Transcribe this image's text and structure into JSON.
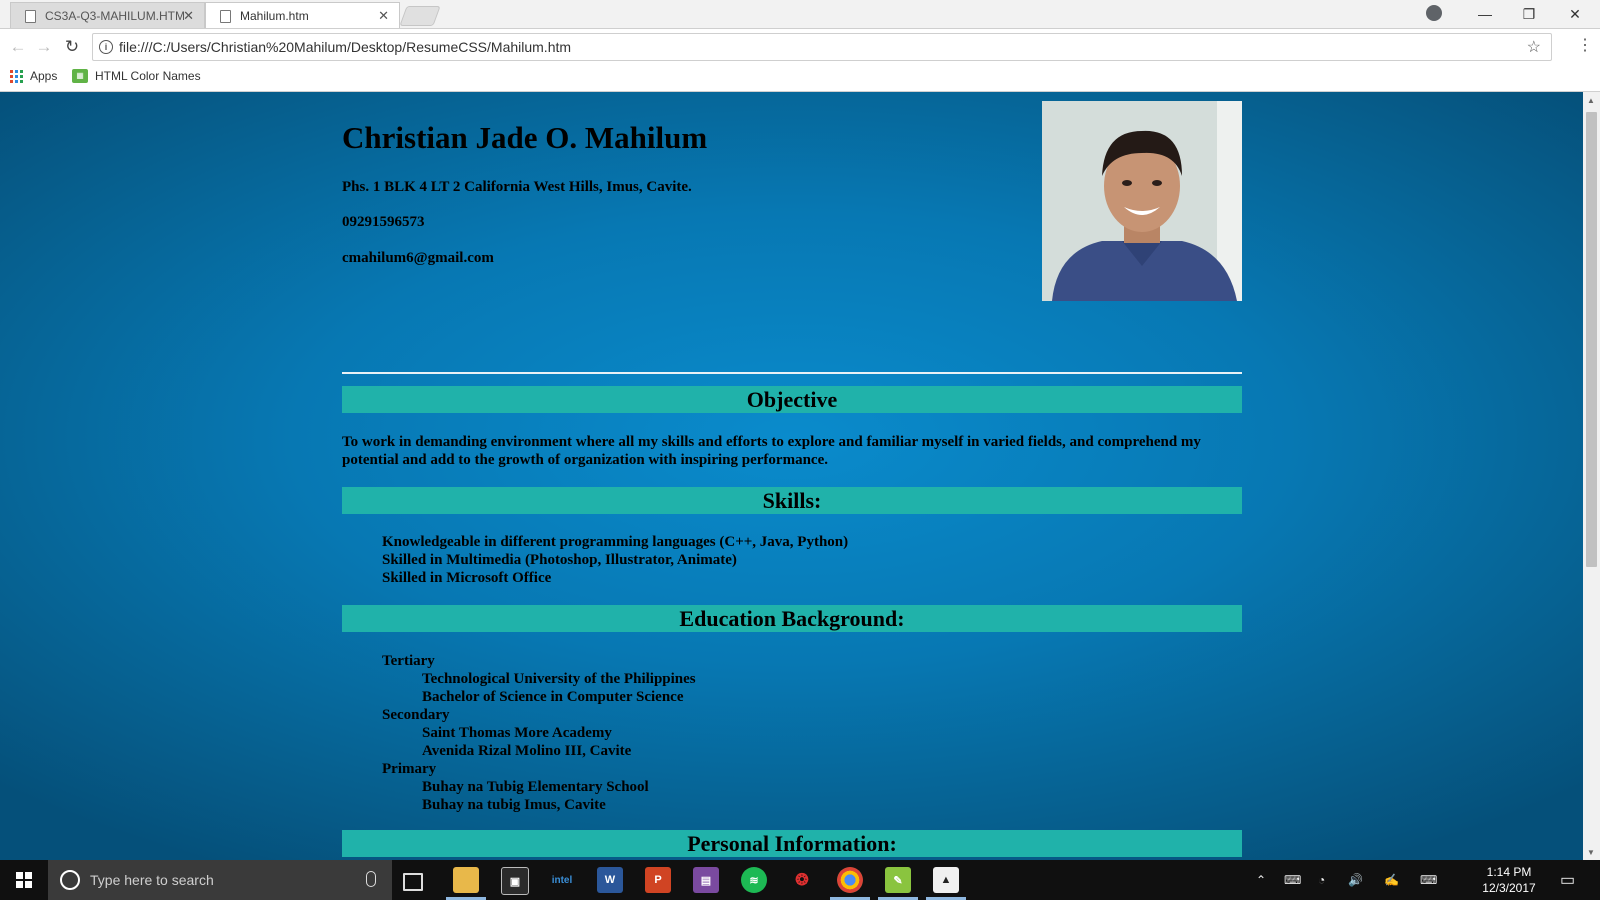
{
  "browser": {
    "tabs": [
      {
        "label": "CS3A-Q3-MAHILUM.HTM",
        "active": false
      },
      {
        "label": "Mahilum.htm",
        "active": true
      }
    ],
    "address": "file:///C:/Users/Christian%20Mahilum/Desktop/ResumeCSS/Mahilum.htm",
    "bookmarks": [
      {
        "label": "Apps",
        "icon": "apps-grid-icon"
      },
      {
        "label": "HTML Color Names",
        "icon": "html-color-names-icon"
      }
    ],
    "window_controls": [
      "minimize",
      "restore",
      "close"
    ]
  },
  "resume": {
    "name": "Christian Jade O. Mahilum",
    "address": "Phs. 1 BLK 4 LT 2 California West Hills, Imus, Cavite.",
    "phone": "09291596573",
    "email": "cmahilum6@gmail.com",
    "sections": {
      "objective": {
        "title": "Objective",
        "text": "To work in demanding environment where all my skills and efforts to explore and familiar myself in varied fields, and comprehend my potential and add to the growth of organization with inspiring performance."
      },
      "skills": {
        "title": "Skills:",
        "items": [
          "Knowledgeable in different programming languages (C++, Java, Python)",
          "Skilled in Multimedia (Photoshop, Illustrator, Animate)",
          "Skilled in Microsoft Office"
        ]
      },
      "education": {
        "title": "Education Background:",
        "levels": [
          {
            "level": "Tertiary",
            "school": "Technological University of the Philippines",
            "detail": "Bachelor of Science in Computer Science"
          },
          {
            "level": "Secondary",
            "school": "Saint Thomas More Academy",
            "detail": "Avenida Rizal Molino III, Cavite"
          },
          {
            "level": "Primary",
            "school": "Buhay na Tubig Elementary School",
            "detail": "Buhay na tubig Imus, Cavite"
          }
        ]
      },
      "personal": {
        "title": "Personal Information:"
      }
    },
    "colors": {
      "section_bar": "#20b2aa",
      "page_bg": "#0a8bcc"
    }
  },
  "taskbar": {
    "search_placeholder": "Type here to search",
    "time": "1:14 PM",
    "date": "12/3/2017"
  }
}
